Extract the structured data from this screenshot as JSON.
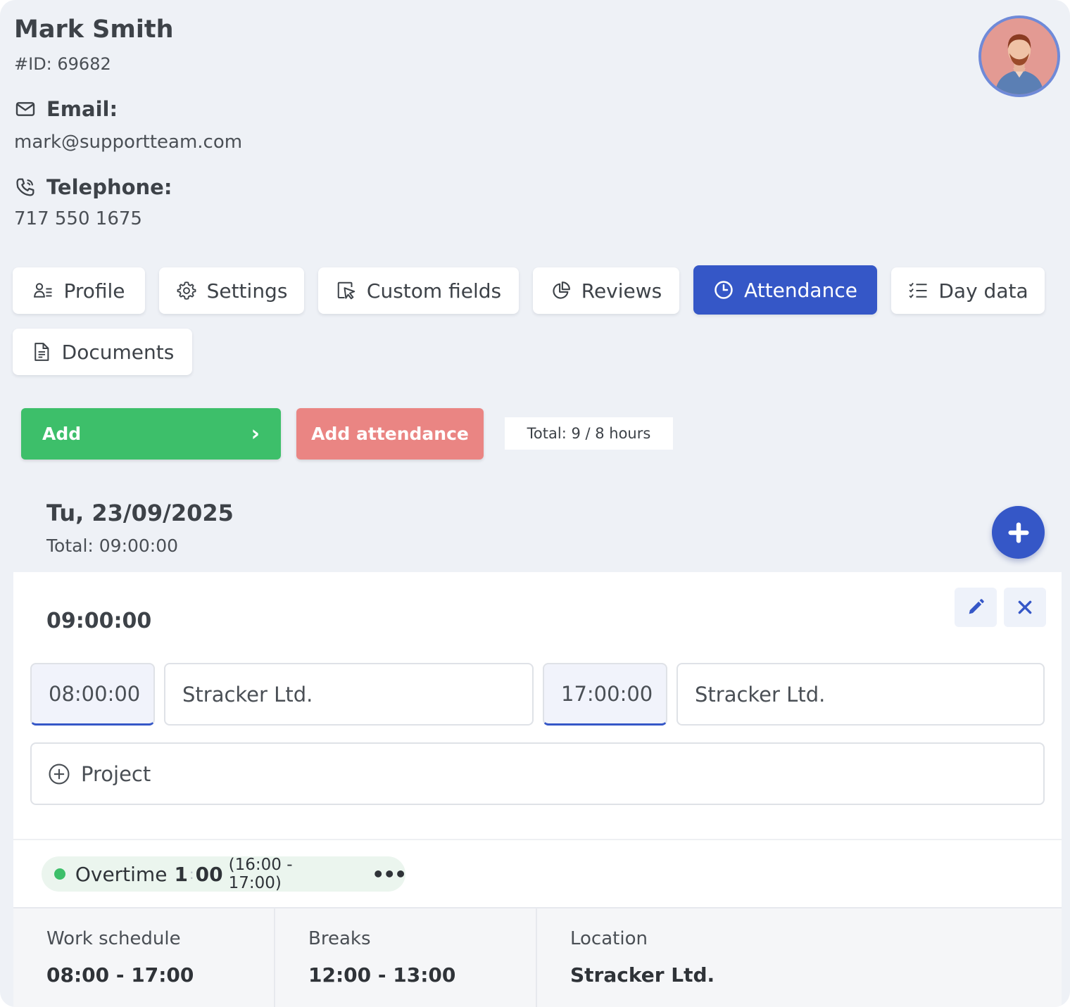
{
  "employee": {
    "name": "Mark Smith",
    "id_text": "#ID: 69682",
    "email_label": "Email:",
    "email": "mark@supportteam.com",
    "phone_label": "Telephone:",
    "phone": "717 550 1675"
  },
  "tabs": [
    {
      "label": "Profile",
      "icon": "profile-list-icon"
    },
    {
      "label": "Settings",
      "icon": "gear-icon"
    },
    {
      "label": "Custom fields",
      "icon": "pointer-icon"
    },
    {
      "label": "Reviews",
      "icon": "pie-chart-icon"
    },
    {
      "label": "Attendance",
      "icon": "clock-icon",
      "active": true
    },
    {
      "label": "Day data",
      "icon": "checklist-icon"
    },
    {
      "label": "Documents",
      "icon": "document-icon"
    }
  ],
  "actions": {
    "add_label": "Add",
    "add_chevron": "›",
    "add_attendance_label": "Add attendance",
    "total_label": "Total: 9 / 8 hours"
  },
  "day": {
    "date": "Tu, 23/09/2025",
    "total": "Total: 09:00:00"
  },
  "entry": {
    "duration": "09:00:00",
    "start_time": "08:00:00",
    "start_location": "Stracker Ltd.",
    "end_time": "17:00:00",
    "end_location": "Stracker Ltd.",
    "project_placeholder": "Project",
    "overtime_label": "Overtime",
    "overtime_hours": "1",
    "overtime_sep": ":",
    "overtime_minutes": "00",
    "overtime_range": "(16:00 - 17:00)",
    "overtime_more": "•••"
  },
  "footer": {
    "schedule_label": "Work schedule",
    "schedule_value": "08:00 - 17:00",
    "breaks_label": "Breaks",
    "breaks_value": "12:00 - 13:00",
    "location_label": "Location",
    "location_value": "Stracker Ltd."
  },
  "colors": {
    "primary": "#3557c7",
    "success": "#3dbf6a",
    "danger": "#ea8583",
    "background": "#eef1f6"
  }
}
